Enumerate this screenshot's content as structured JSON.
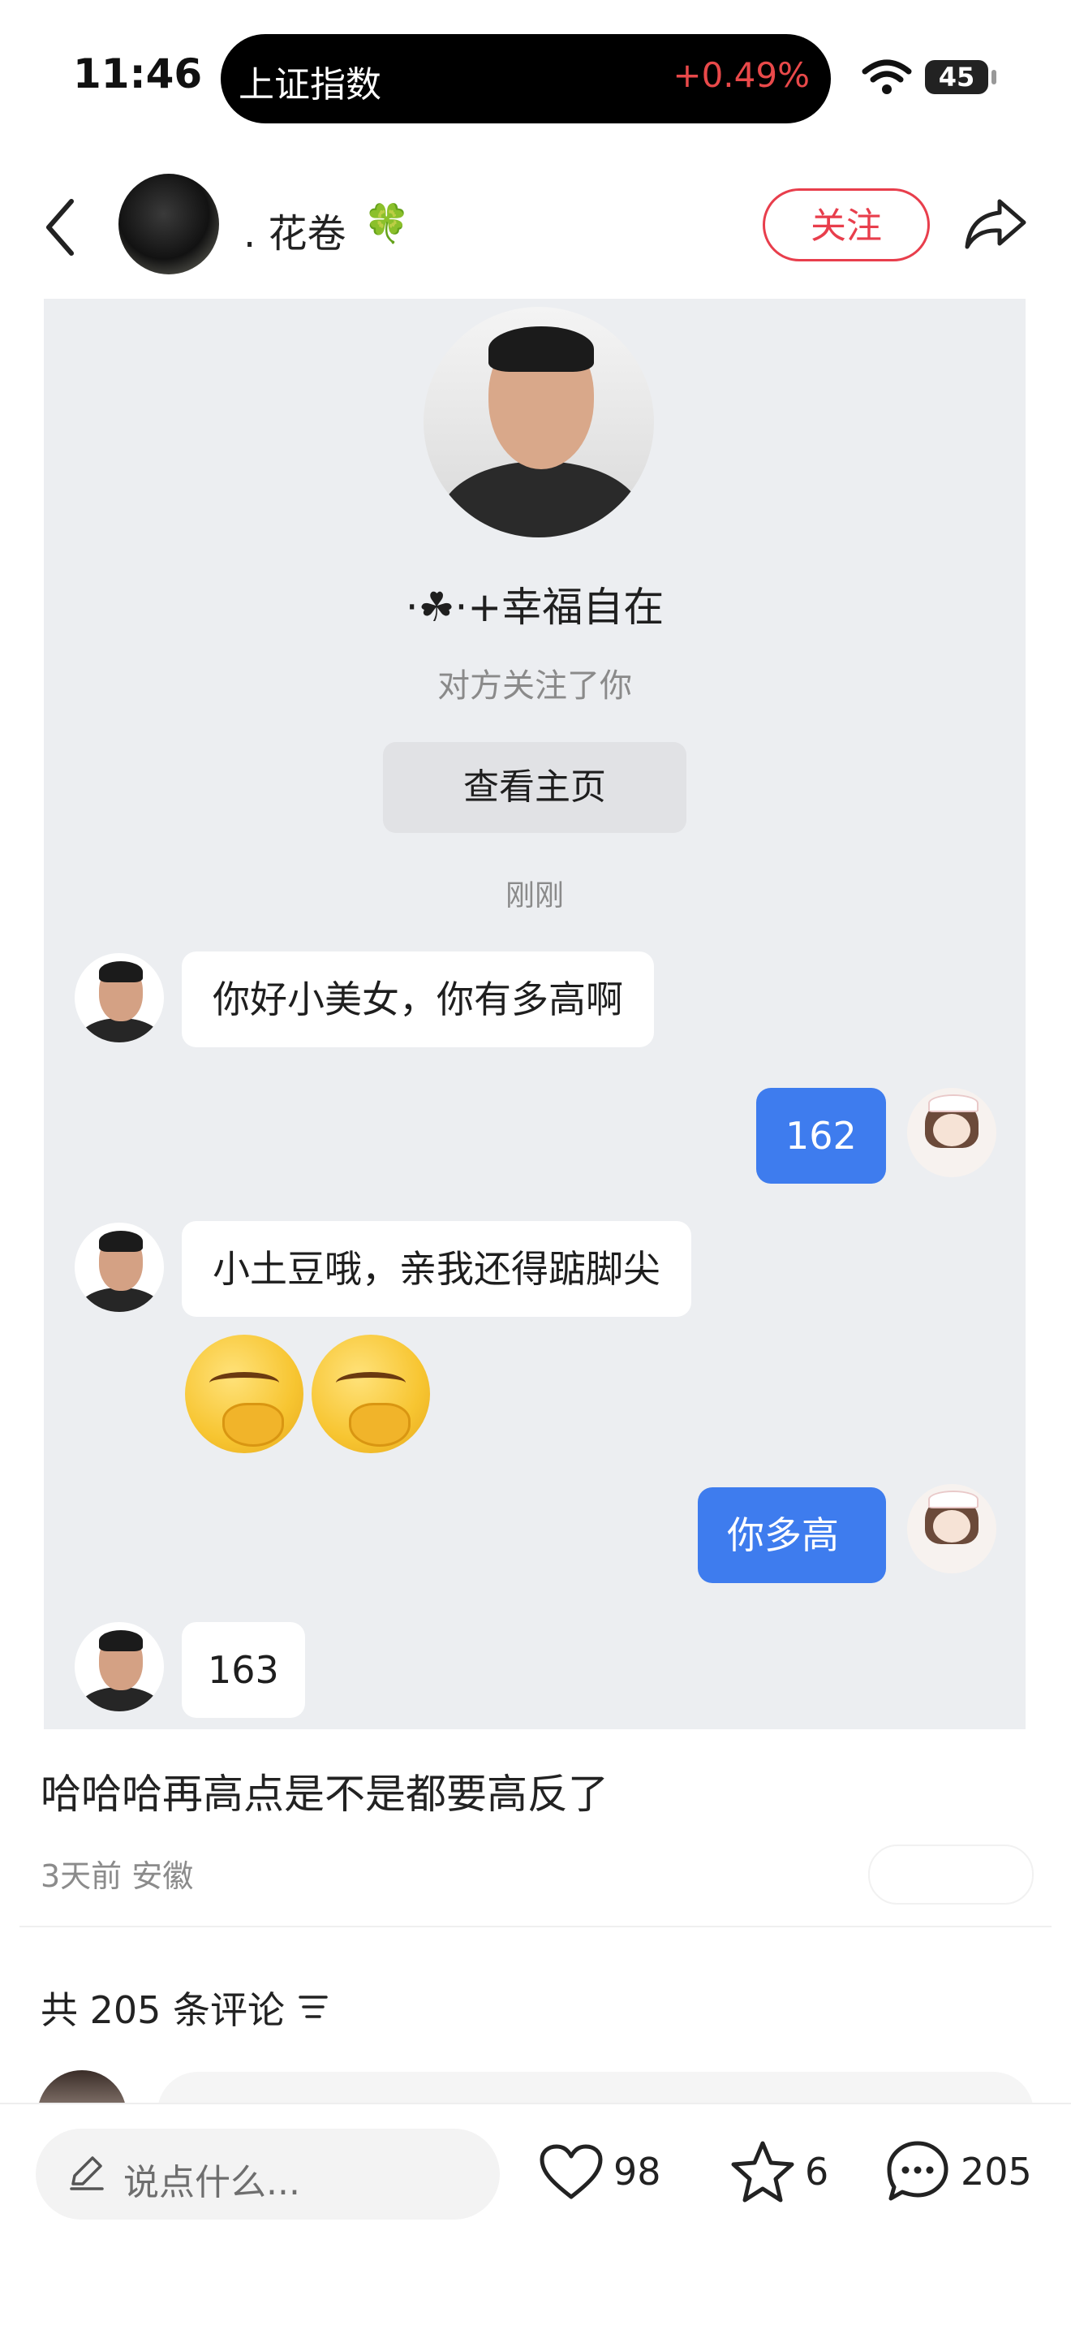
{
  "status_bar": {
    "time": "11:46",
    "ticker_name": "上证指数",
    "ticker_value": "+0.49%",
    "battery": "45"
  },
  "header": {
    "author_name": ". 花卷",
    "author_emoji": "🍀",
    "follow_label": "关注"
  },
  "screenshot": {
    "profile_name": "·☘·+幸福自在 ",
    "profile_sub": "对方关注了你",
    "view_home_label": "查看主页",
    "time_label": "刚刚",
    "messages": [
      {
        "side": "left",
        "text": "你好小美女，你有多高啊"
      },
      {
        "side": "right",
        "text": "162"
      },
      {
        "side": "left",
        "text": "小土豆哦，亲我还得踮脚尖"
      },
      {
        "side": "right",
        "text": "你多高"
      },
      {
        "side": "left",
        "text": "163"
      }
    ]
  },
  "post": {
    "caption": "哈哈哈再高点是不是都要高反了",
    "meta": "3天前 安徽",
    "comments_title": "共 205 条评论"
  },
  "bottom_bar": {
    "input_placeholder": "说点什么...",
    "like_count": "98",
    "star_count": "6",
    "comment_count": "205"
  },
  "colors": {
    "accent_red": "#e83e4c",
    "bubble_blue": "#3e7cee",
    "ticker_up": "#e9494a"
  }
}
